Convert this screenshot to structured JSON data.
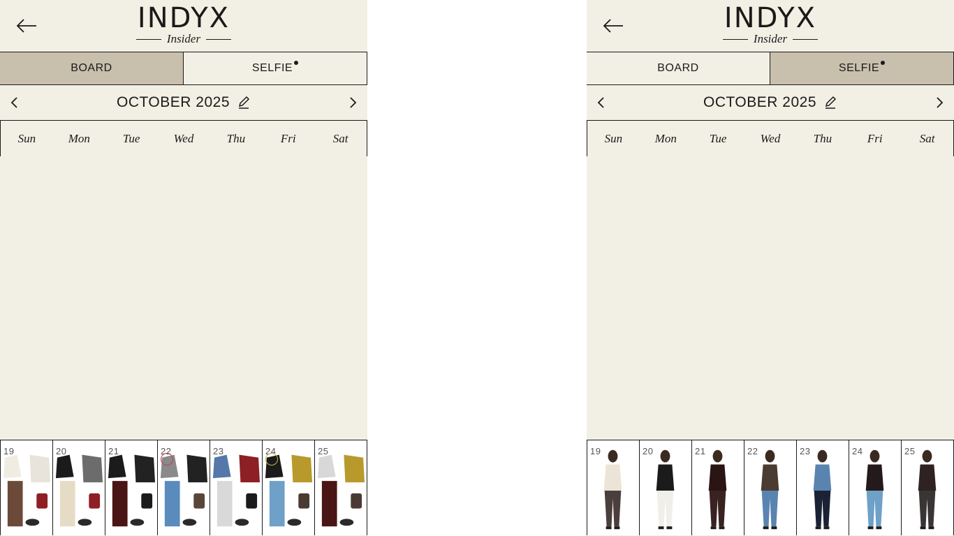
{
  "app": {
    "logo_main": "INDYX",
    "logo_sub": "Insider"
  },
  "panels": [
    {
      "tabs": [
        {
          "label": "BOARD",
          "active": true
        },
        {
          "label": "SELFIE",
          "active": false,
          "dot": true
        }
      ],
      "month": "OCTOBER 2025",
      "weekdays": [
        "Sun",
        "Mon",
        "Tue",
        "Wed",
        "Thu",
        "Fri",
        "Sat"
      ],
      "days": [
        {
          "num": "19",
          "type": "flatlay"
        },
        {
          "num": "20",
          "type": "flatlay"
        },
        {
          "num": "21",
          "type": "flatlay"
        },
        {
          "num": "22",
          "type": "flatlay",
          "ring": "#b8424d"
        },
        {
          "num": "23",
          "type": "flatlay"
        },
        {
          "num": "24",
          "type": "flatlay",
          "ring": "#c9b34a"
        },
        {
          "num": "25",
          "type": "flatlay"
        }
      ]
    },
    {
      "tabs": [
        {
          "label": "BOARD",
          "active": false
        },
        {
          "label": "SELFIE",
          "active": true,
          "dot": true
        }
      ],
      "month": "OCTOBER 2025",
      "weekdays": [
        "Sun",
        "Mon",
        "Tue",
        "Wed",
        "Thu",
        "Fri",
        "Sat"
      ],
      "days": [
        {
          "num": "19",
          "type": "selfie"
        },
        {
          "num": "20",
          "type": "selfie"
        },
        {
          "num": "21",
          "type": "selfie"
        },
        {
          "num": "22",
          "type": "selfie"
        },
        {
          "num": "23",
          "type": "selfie"
        },
        {
          "num": "24",
          "type": "selfie"
        },
        {
          "num": "25",
          "type": "selfie"
        }
      ]
    }
  ],
  "icons": {
    "back": "arrow-left-icon",
    "prev": "chevron-left-icon",
    "next": "chevron-right-icon",
    "edit": "pencil-icon"
  },
  "colors": {
    "background": "#f2efe4",
    "active_tab": "#c9bfad",
    "ink": "#1a1a1a"
  }
}
